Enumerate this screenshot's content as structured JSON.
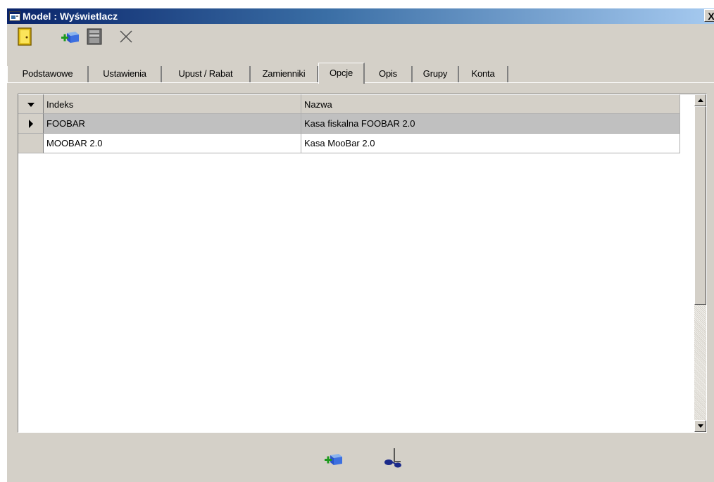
{
  "window": {
    "title": "Model : Wyświetlacz",
    "close_label": "X",
    "icons": {
      "app": "app-window-icon",
      "close": "close-icon"
    }
  },
  "toolbar": {
    "buttons": [
      {
        "icon": "exit-door-icon"
      },
      {
        "icon": "add-item-icon"
      },
      {
        "icon": "save-icon"
      },
      {
        "icon": "cancel-x-icon"
      }
    ]
  },
  "tabs": [
    {
      "label": "Podstawowe",
      "active": false
    },
    {
      "label": "Ustawienia",
      "active": false
    },
    {
      "label": "Upust / Rabat",
      "active": false
    },
    {
      "label": "Zamienniki",
      "active": false
    },
    {
      "label": "Opcje",
      "active": true
    },
    {
      "label": "Opis",
      "active": false
    },
    {
      "label": "Grupy",
      "active": false
    },
    {
      "label": "Konta",
      "active": false
    }
  ],
  "grid": {
    "columns": [
      "Indeks",
      "Nazwa"
    ],
    "rows": [
      {
        "indeks": "FOOBAR",
        "nazwa": "Kasa fiskalna FOOBAR 2.0",
        "selected": true
      },
      {
        "indeks": "MOOBAR 2.0",
        "nazwa": "Kasa MooBar 2.0",
        "selected": false
      }
    ]
  },
  "bottom": {
    "buttons": [
      {
        "icon": "add-item-icon"
      },
      {
        "icon": "cut-scissors-icon"
      }
    ]
  },
  "colors": {
    "titlebar_start": "#0a246a",
    "titlebar_end": "#a6caf0",
    "face": "#d4d0c8",
    "selected_row": "#c0c0c0"
  }
}
